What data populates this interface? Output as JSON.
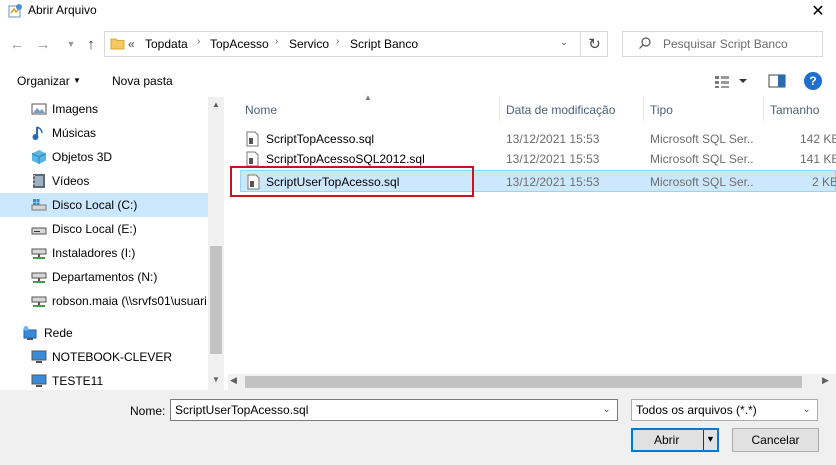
{
  "window": {
    "title": "Abrir Arquivo",
    "close_glyph": "✕"
  },
  "address": {
    "overflow": "«",
    "breadcrumbs": [
      "Topdata",
      "TopAcesso",
      "Servico",
      "Script Banco"
    ],
    "separator": "›"
  },
  "search": {
    "placeholder": "Pesquisar Script Banco"
  },
  "toolbar": {
    "organize_label": "Organizar",
    "new_folder_label": "Nova pasta",
    "help_label": "?"
  },
  "nav": {
    "items": [
      {
        "label": "Imagens",
        "icon": "pictures-icon"
      },
      {
        "label": "Músicas",
        "icon": "music-icon"
      },
      {
        "label": "Objetos 3D",
        "icon": "objects-3d-icon"
      },
      {
        "label": "Vídeos",
        "icon": "videos-icon"
      },
      {
        "label": "Disco Local (C:)",
        "icon": "drive-icon",
        "selected": true
      },
      {
        "label": "Disco Local (E:)",
        "icon": "drive-icon"
      },
      {
        "label": "Instaladores (I:)",
        "icon": "network-drive-icon"
      },
      {
        "label": "Departamentos (N:)",
        "icon": "network-drive-icon"
      },
      {
        "label": "robson.maia (\\\\srvfs01\\usuari",
        "icon": "network-drive-icon"
      },
      {
        "label": "Rede",
        "icon": "network-icon"
      },
      {
        "label": "NOTEBOOK-CLEVER",
        "icon": "computer-icon"
      },
      {
        "label": "TESTE11",
        "icon": "computer-icon"
      }
    ]
  },
  "columns": {
    "name": "Nome",
    "modified": "Data de modificação",
    "type": "Tipo",
    "size": "Tamanho"
  },
  "files": [
    {
      "name": "ScriptTopAcesso.sql",
      "modified": "13/12/2021 15:53",
      "type": "Microsoft SQL Ser...",
      "size": "142 KB"
    },
    {
      "name": "ScriptTopAcessoSQL2012.sql",
      "modified": "13/12/2021 15:53",
      "type": "Microsoft SQL Ser...",
      "size": "141 KB"
    },
    {
      "name": "ScriptUserTopAcesso.sql",
      "modified": "13/12/2021 15:53",
      "type": "Microsoft SQL Ser...",
      "size": "2 KB",
      "selected": true
    }
  ],
  "bottom": {
    "name_label": "Nome:",
    "file_name_value": "ScriptUserTopAcesso.sql",
    "file_type": "Todos os arquivos (*.*)",
    "open_label": "Abrir",
    "cancel_label": "Cancelar"
  },
  "colors": {
    "selection": "#cce8ff",
    "highlight_border": "#c4161c",
    "accent": "#0078d7"
  }
}
